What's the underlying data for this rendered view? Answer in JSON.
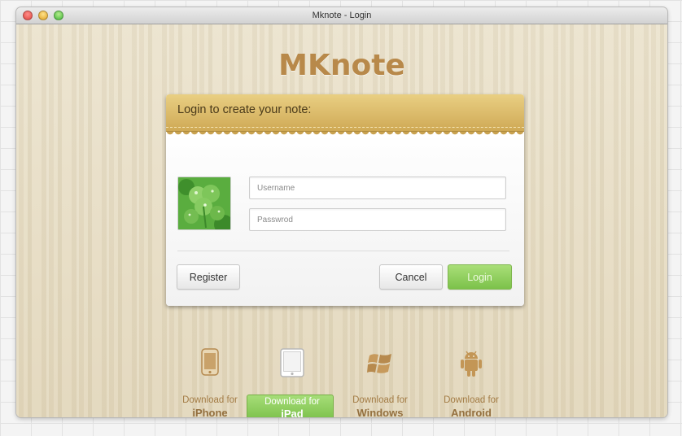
{
  "window": {
    "title": "Mknote - Login"
  },
  "app": {
    "logo": "MKnote"
  },
  "login": {
    "heading": "Login to create your note:",
    "username_placeholder": "Username",
    "password_placeholder": "Passwrod",
    "register_label": "Register",
    "cancel_label": "Cancel",
    "login_label": "Login"
  },
  "downloads": [
    {
      "prefix": "Download for",
      "platform": "iPhone",
      "icon": "iphone-icon",
      "active": false
    },
    {
      "prefix": "Download for",
      "platform": "iPad",
      "icon": "ipad-icon",
      "active": true
    },
    {
      "prefix": "Download for",
      "platform": "Windows",
      "icon": "windows-icon",
      "active": false
    },
    {
      "prefix": "Download for",
      "platform": "Android",
      "icon": "android-icon",
      "active": false
    }
  ],
  "colors": {
    "accent": "#7cc24a",
    "header": "#d8b463",
    "logo": "#b8894a"
  }
}
